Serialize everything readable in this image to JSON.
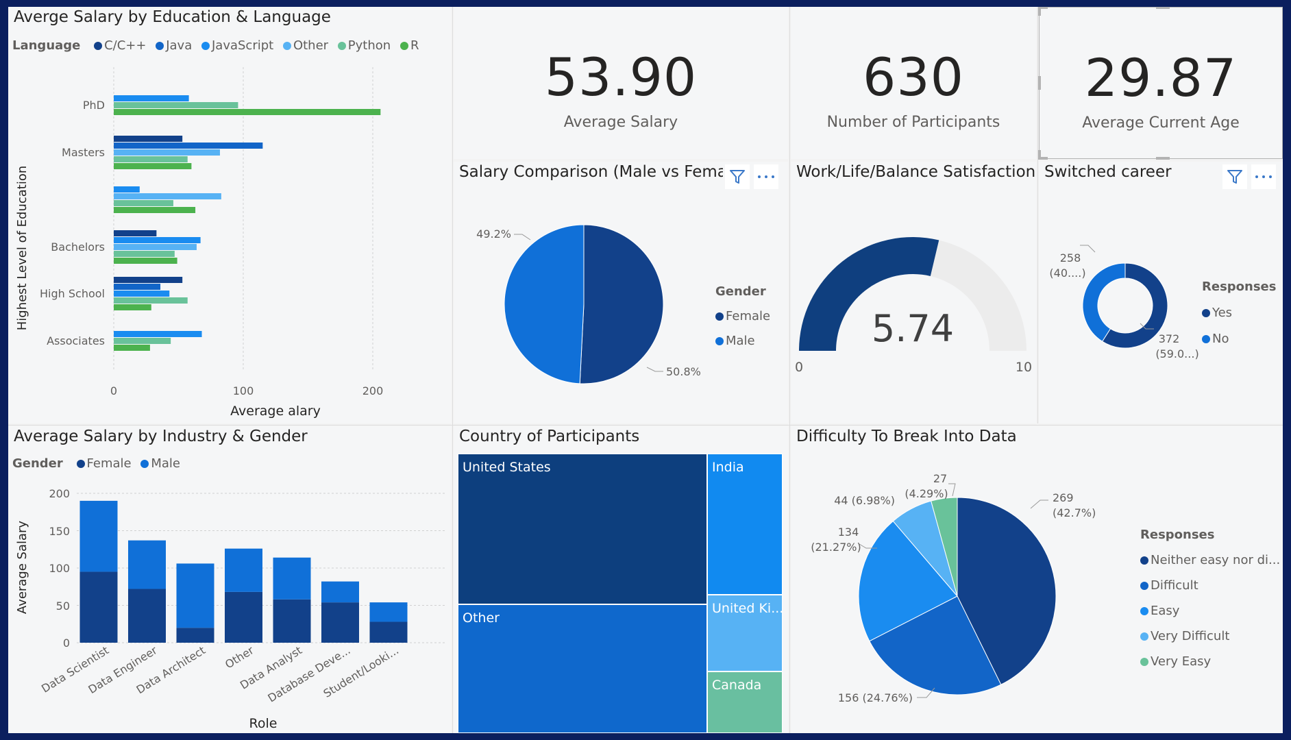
{
  "education_chart": {
    "title": "Averge Salary by Education & Language",
    "legend_title": "Language",
    "legend": [
      {
        "label": "C/C++",
        "color": "#12418a"
      },
      {
        "label": "Java",
        "color": "#1265c8"
      },
      {
        "label": "JavaScript",
        "color": "#1a8cf0"
      },
      {
        "label": "Other",
        "color": "#57b2f4"
      },
      {
        "label": "Python",
        "color": "#69c29a"
      },
      {
        "label": "R",
        "color": "#4cb24e"
      }
    ],
    "y_title": "Highest Level of Education",
    "x_title": "Average alary",
    "x_ticks": [
      "0",
      "100",
      "200"
    ],
    "category_labels": [
      "PhD",
      "Masters",
      "",
      "Bachelors",
      "High School",
      "Associates"
    ]
  },
  "kpis": [
    {
      "value": "53.90",
      "label": "Average Salary"
    },
    {
      "value": "630",
      "label": "Number of Participants"
    },
    {
      "value": "29.87",
      "label": "Average Current Age"
    }
  ],
  "salary_comparison": {
    "title": "Salary Comparison (Male vs Female)",
    "legend_title": "Gender",
    "legend": [
      {
        "label": "Female",
        "color": "#12418a"
      },
      {
        "label": "Male",
        "color": "#1070d8"
      }
    ],
    "label_male": "49.2%",
    "label_female": "50.8%"
  },
  "gauge": {
    "title": "Work/Life/Balance Satisfaction",
    "value": "5.74",
    "min": "0",
    "max": "10"
  },
  "switched_career": {
    "title": "Switched career",
    "legend_title": "Responses",
    "legend": [
      {
        "label": "Yes",
        "color": "#12418a"
      },
      {
        "label": "No",
        "color": "#1070d8"
      }
    ],
    "label_no_count": "258",
    "label_no_pct": "(40....)",
    "label_yes_count": "372",
    "label_yes_pct": "(59.0...)"
  },
  "industry_chart": {
    "title": "Average Salary by Industry & Gender",
    "legend_title": "Gender",
    "legend": [
      {
        "label": "Female",
        "color": "#12418a"
      },
      {
        "label": "Male",
        "color": "#1070d8"
      }
    ],
    "y_title": "Average Salary",
    "x_title": "Role",
    "y_ticks": [
      "200",
      "150",
      "100",
      "50",
      "0"
    ]
  },
  "country": {
    "title": "Country of Participants",
    "cells": {
      "us": "United States",
      "other": "Other",
      "india": "India",
      "uk": "United Ki...",
      "canada": "Canada"
    }
  },
  "difficulty": {
    "title": "Difficulty To Break Into Data",
    "legend_title": "Responses",
    "legend": [
      {
        "label": "Neither easy nor di...",
        "color": "#12418a"
      },
      {
        "label": "Difficult",
        "color": "#1265c8"
      },
      {
        "label": "Easy",
        "color": "#1a8cf0"
      },
      {
        "label": "Very Difficult",
        "color": "#57b2f4"
      },
      {
        "label": "Very Easy",
        "color": "#69c29a"
      }
    ],
    "labels": {
      "neither_count": "269",
      "neither_pct": "(42.7%)",
      "difficult": "156 (24.76%)",
      "easy_count": "134",
      "easy_pct": "(21.27%)",
      "very_difficult": "44 (6.98%)",
      "very_easy_count": "27",
      "very_easy_pct": "(4.29%)"
    }
  },
  "chart_data": [
    {
      "type": "bar",
      "orientation": "horizontal",
      "title": "Averge Salary by Education & Language",
      "xlabel": "Average alary",
      "ylabel": "Highest Level of Education",
      "xlim": [
        0,
        240
      ],
      "categories": [
        "PhD",
        "Masters",
        "",
        "Bachelors",
        "High School",
        "Associates"
      ],
      "series": [
        {
          "name": "C/C++",
          "values": [
            null,
            53,
            null,
            33,
            53,
            null
          ]
        },
        {
          "name": "Java",
          "values": [
            null,
            115,
            null,
            null,
            36,
            null
          ]
        },
        {
          "name": "JavaScript",
          "values": [
            58,
            null,
            20,
            67,
            43,
            68
          ]
        },
        {
          "name": "Other",
          "values": [
            null,
            82,
            83,
            64,
            null,
            null
          ]
        },
        {
          "name": "Python",
          "values": [
            96,
            57,
            46,
            47,
            57,
            44
          ]
        },
        {
          "name": "R",
          "values": [
            206,
            60,
            63,
            49,
            29,
            28
          ]
        }
      ]
    },
    {
      "type": "pie",
      "title": "Salary Comparison (Male vs Female)",
      "categories": [
        "Female",
        "Male"
      ],
      "values": [
        50.8,
        49.2
      ]
    },
    {
      "type": "gauge",
      "title": "Work/Life/Balance Satisfaction",
      "value": 5.74,
      "min": 0,
      "max": 10
    },
    {
      "type": "pie",
      "subtype": "donut",
      "title": "Switched career",
      "categories": [
        "Yes",
        "No"
      ],
      "values": [
        372,
        258
      ]
    },
    {
      "type": "bar",
      "stacked": true,
      "title": "Average Salary by Industry & Gender",
      "xlabel": "Role",
      "ylabel": "Average Salary",
      "ylim": [
        0,
        200
      ],
      "categories": [
        "Data Scientist",
        "Data Engineer",
        "Data Architect",
        "Other",
        "Data Analyst",
        "Database Deve...",
        "Student/Looki..."
      ],
      "series": [
        {
          "name": "Female",
          "values": [
            95,
            72,
            20,
            68,
            58,
            54,
            28
          ]
        },
        {
          "name": "Male",
          "values": [
            95,
            65,
            86,
            58,
            56,
            28,
            26
          ]
        }
      ]
    },
    {
      "type": "treemap",
      "title": "Country of Participants",
      "categories": [
        "United States",
        "Other",
        "India",
        "United Ki...",
        "Canada"
      ]
    },
    {
      "type": "pie",
      "title": "Difficulty To Break Into Data",
      "categories": [
        "Neither easy nor di...",
        "Difficult",
        "Easy",
        "Very Difficult",
        "Very Easy"
      ],
      "values": [
        269,
        156,
        134,
        44,
        27
      ]
    }
  ]
}
